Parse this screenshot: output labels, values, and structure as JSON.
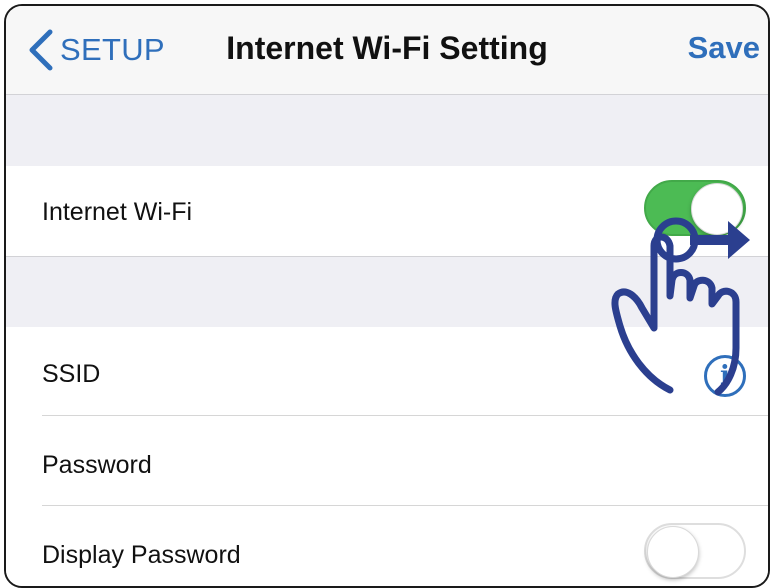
{
  "navbar": {
    "back_label": "SETUP",
    "title": "Internet Wi-Fi Setting",
    "save_label": "Save"
  },
  "rows": {
    "internet_wifi": {
      "label": "Internet Wi-Fi",
      "toggle_on": true
    },
    "ssid": {
      "label": "SSID",
      "info_glyph": "i"
    },
    "password": {
      "label": "Password"
    },
    "display_password": {
      "label": "Display Password",
      "toggle_on": false
    }
  },
  "icons": [
    "chevron-left-icon",
    "info-icon",
    "hand-swipe-icon",
    "arrow-right-icon"
  ],
  "colors": {
    "accent": "#2f6fbb",
    "toggle_on": "#4cbb54",
    "group_background": "#efeff4",
    "hand_outline": "#2b3f8f"
  }
}
